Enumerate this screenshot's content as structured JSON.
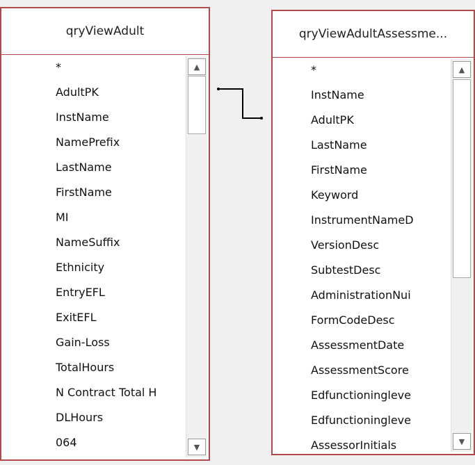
{
  "tables": [
    {
      "title": "qryViewAdult",
      "fields": [
        "*",
        "AdultPK",
        "InstName",
        "NamePrefix",
        "LastName",
        "FirstName",
        "MI",
        "NameSuffix",
        "Ethnicity",
        "EntryEFL",
        "ExitEFL",
        "Gain-Loss",
        "TotalHours",
        "N Contract Total H",
        "DLHours",
        "064"
      ]
    },
    {
      "title": "qryViewAdultAssessme...",
      "fields": [
        "*",
        "InstName",
        "AdultPK",
        "LastName",
        "FirstName",
        "Keyword",
        "InstrumentNameD",
        "VersionDesc",
        "SubtestDesc",
        "AdministrationNui",
        "FormCodeDesc",
        "AssessmentDate",
        "AssessmentScore",
        "Edfunctioningleve",
        "Edfunctioningleve",
        "AssessorInitials"
      ]
    }
  ],
  "icons": {
    "scroll_up": "▲",
    "scroll_down": "▼"
  },
  "colors": {
    "border": "#b04a4a",
    "background": "#f0f0f0",
    "join_line": "#000000"
  }
}
